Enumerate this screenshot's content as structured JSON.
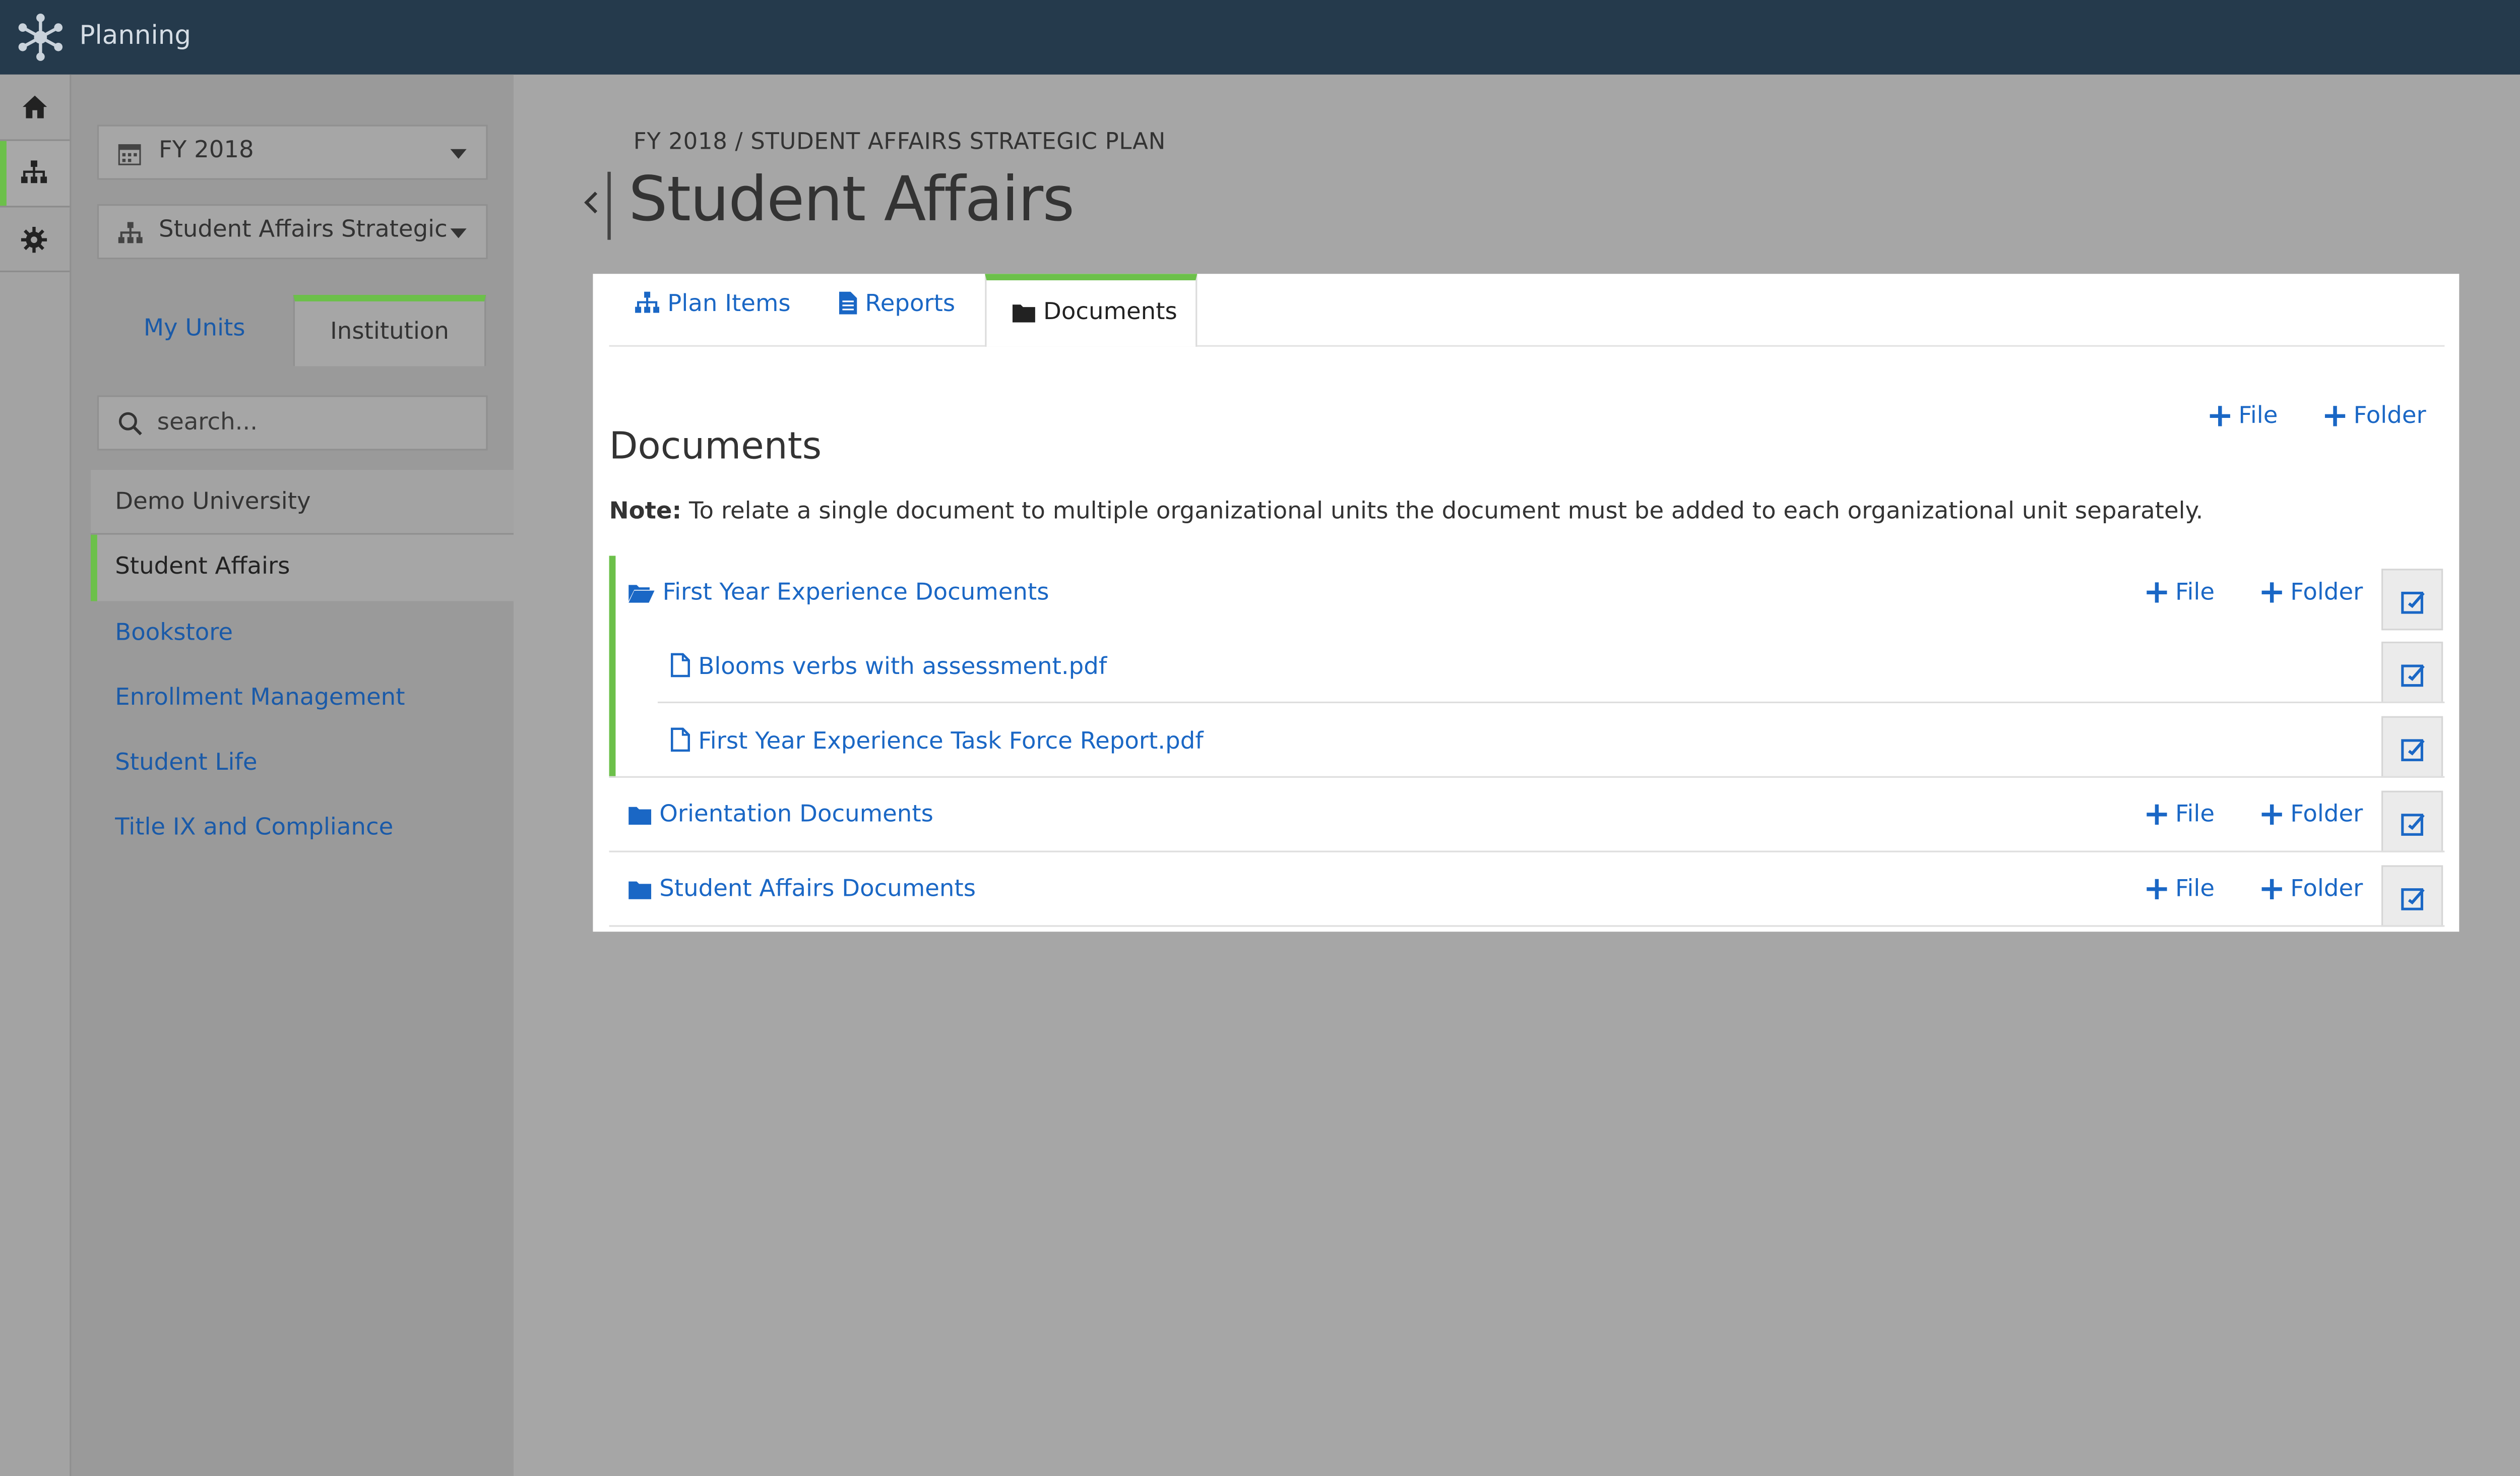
{
  "app": {
    "title": "Planning"
  },
  "sidebar": {
    "fiscal_year": "FY 2018",
    "plan": "Student Affairs Strategic Plan",
    "unit_tabs": [
      {
        "label": "My Units"
      },
      {
        "label": "Institution"
      }
    ],
    "search_placeholder": "search...",
    "units": [
      {
        "label": "Demo University"
      },
      {
        "label": "Student Affairs"
      },
      {
        "label": "Bookstore"
      },
      {
        "label": "Enrollment Management"
      },
      {
        "label": "Student Life"
      },
      {
        "label": "Title IX and Compliance"
      }
    ]
  },
  "header": {
    "breadcrumb": "FY 2018 / STUDENT AFFAIRS STRATEGIC PLAN",
    "title": "Student Affairs"
  },
  "tabs": [
    {
      "label": "Plan Items"
    },
    {
      "label": "Reports"
    },
    {
      "label": "Documents"
    }
  ],
  "documents": {
    "heading": "Documents",
    "note_label": "Note:",
    "note_text": " To relate a single document to multiple organizational units the document must be added to each organizational unit separately.",
    "add_file": "File",
    "add_folder": "Folder",
    "folders": [
      {
        "name": "First Year Experience Documents",
        "files": [
          {
            "name": "Blooms verbs with assessment.pdf"
          },
          {
            "name": "First Year Experience Task Force Report.pdf"
          }
        ]
      },
      {
        "name": "Orientation Documents"
      },
      {
        "name": "Student Affairs Documents"
      }
    ]
  },
  "colors": {
    "topbar": "#253a4c",
    "accent_green": "#6cc04a",
    "link_blue": "#1a67c5"
  }
}
